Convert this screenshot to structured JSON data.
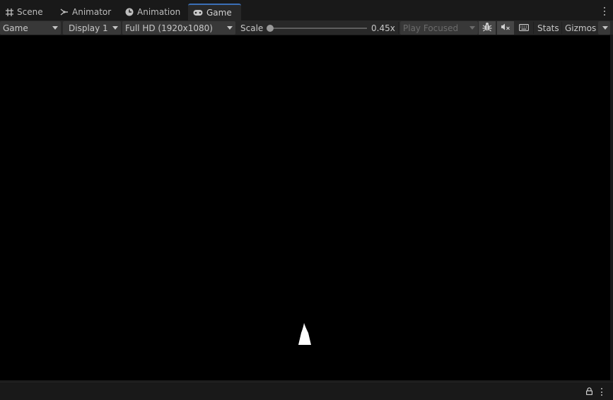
{
  "tabs": [
    {
      "label": "Scene",
      "icon": "grid-icon"
    },
    {
      "label": "Animator",
      "icon": "animator-icon"
    },
    {
      "label": "Animation",
      "icon": "clock-icon"
    },
    {
      "label": "Game",
      "icon": "gamepad-icon",
      "active": true
    }
  ],
  "toolbar": {
    "view_mode": "Game",
    "display": "Display 1",
    "resolution": "Full HD (1920x1080)",
    "scale_label": "Scale",
    "scale_value": "0.45x",
    "play_mode": "Play Focused",
    "stats_label": "Stats",
    "gizmos_label": "Gizmos"
  },
  "colors": {
    "background": "#191919",
    "toolbar": "#282828",
    "viewport": "#000000",
    "active_tab_accent": "#3b6fb6",
    "ship": "#ffffff"
  }
}
